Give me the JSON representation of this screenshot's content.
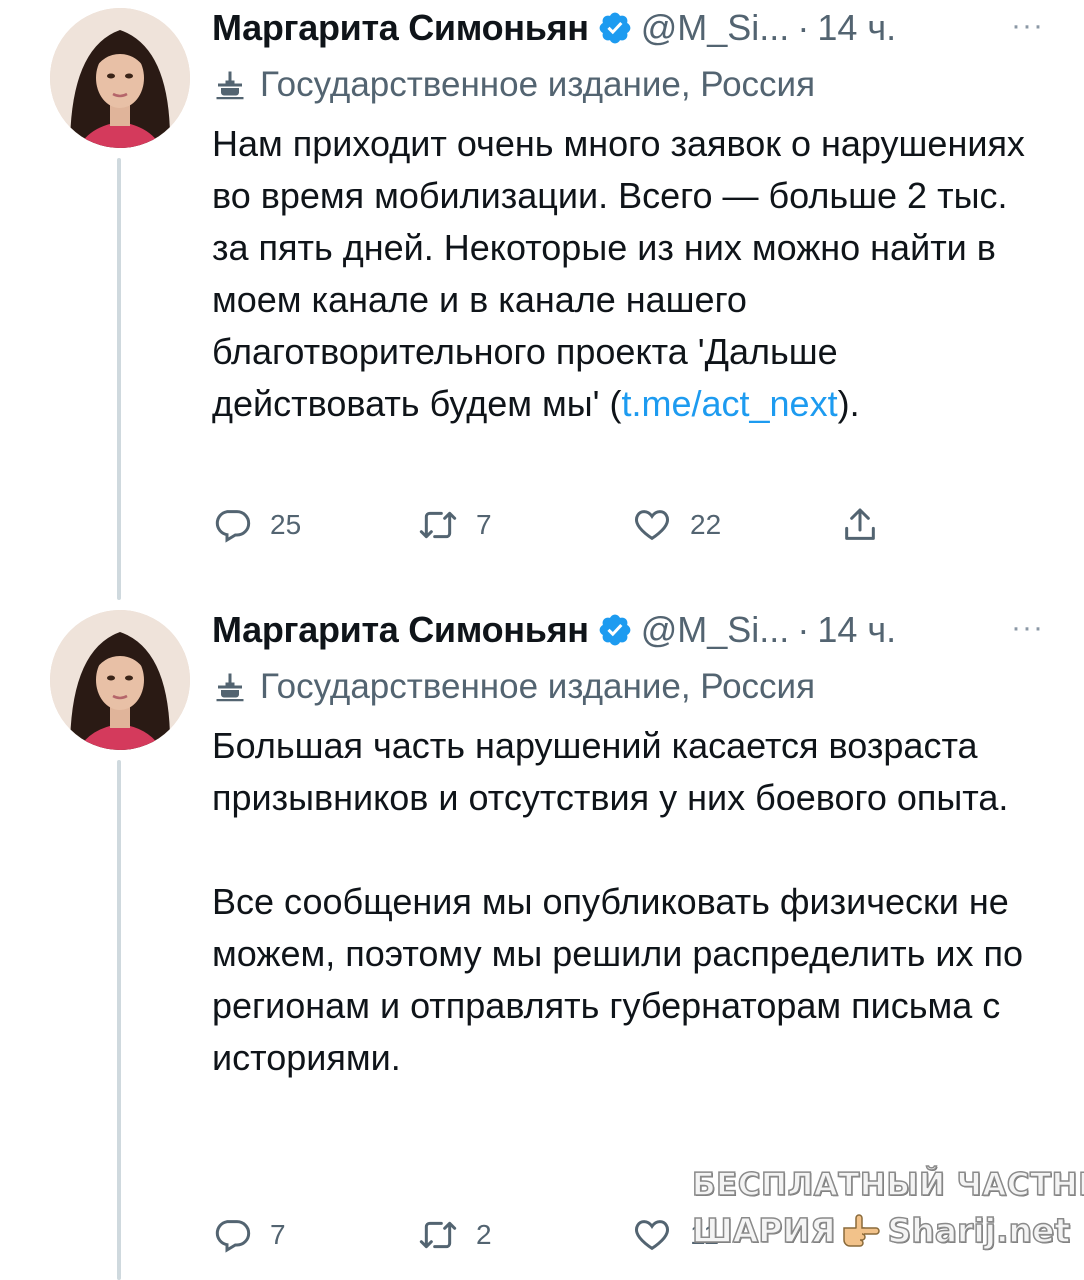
{
  "colors": {
    "text": "#0f1419",
    "secondary": "#536471",
    "link": "#1d9bf0",
    "verified": "#1d9bf0",
    "thread_line": "#cfd9de",
    "background": "#ffffff"
  },
  "tweets": [
    {
      "author_name": "Маргарита Симоньян",
      "handle": "@M_Si...",
      "separator": "·",
      "time": "14 ч.",
      "more": "···",
      "label": "Государственное издание, Россия",
      "label_icon": "government-building-icon",
      "text_before_link": "Нам приходит очень много заявок о нарушениях во время мобилизации. Всего — больше 2 тыс. за пять дней. Некоторые из них можно найти в моем канале и в канале нашего благотворительного проекта 'Дальше действовать будем мы' (",
      "link": "t.me/act_next",
      "text_after_link": ").",
      "replies": "25",
      "retweets": "7",
      "likes": "22"
    },
    {
      "author_name": "Маргарита Симоньян",
      "handle": "@M_Si...",
      "separator": "·",
      "time": "14 ч.",
      "more": "···",
      "label": "Государственное издание, Россия",
      "label_icon": "government-building-icon",
      "paragraph_1": "Большая часть нарушений касается возраста призывников и отсутствия у них боевого опыта.",
      "paragraph_2": "Все сообщения мы опубликовать физически не можем, поэтому мы решили распределить их по регионам и отправлять губернаторам письма с историями.",
      "replies": "7",
      "retweets": "2",
      "likes": "11"
    }
  ],
  "watermark": {
    "line1": "БЕСПЛАТНЫЙ ЧАСТНЫЙ",
    "line2_left": "ШАРИЯ",
    "line2_right": "Sharij.net"
  }
}
